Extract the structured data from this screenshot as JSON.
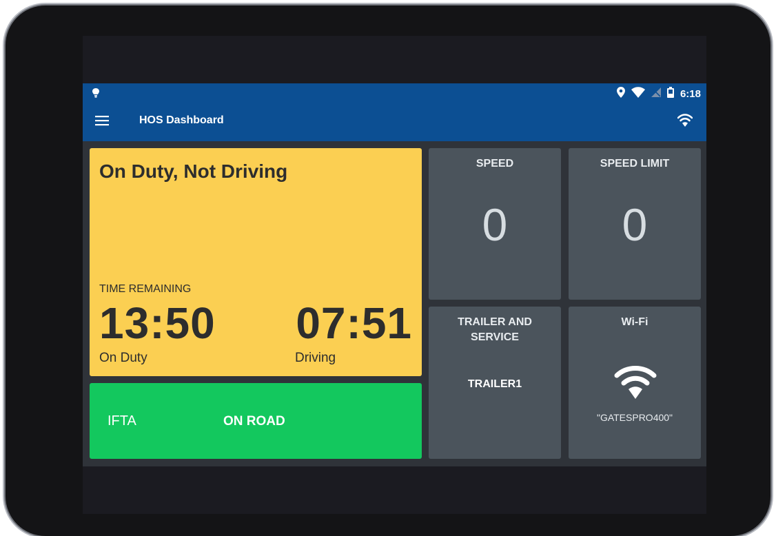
{
  "statusbar": {
    "time": "6:18"
  },
  "appbar": {
    "title": "HOS Dashboard"
  },
  "duty_status": {
    "title": "On Duty, Not Driving",
    "time_remaining_label": "TIME REMAINING",
    "on_duty_time": "13:50",
    "on_duty_label": "On Duty",
    "driving_time": "07:51",
    "driving_label": "Driving"
  },
  "ifta": {
    "label": "IFTA",
    "status": "ON ROAD"
  },
  "speed": {
    "label": "SPEED",
    "value": "0"
  },
  "speed_limit": {
    "label": "SPEED LIMIT",
    "value": "0"
  },
  "trailer": {
    "label": "TRAILER AND SERVICE",
    "value": "TRAILER1"
  },
  "wifi": {
    "label": "Wi-Fi",
    "ssid": "\"GATESPRO400\""
  },
  "colors": {
    "appbar": "#0c4f93",
    "duty_card": "#fbcf52",
    "ifta_card": "#13c85e",
    "tile": "#4b545c",
    "background": "#2f3339"
  }
}
